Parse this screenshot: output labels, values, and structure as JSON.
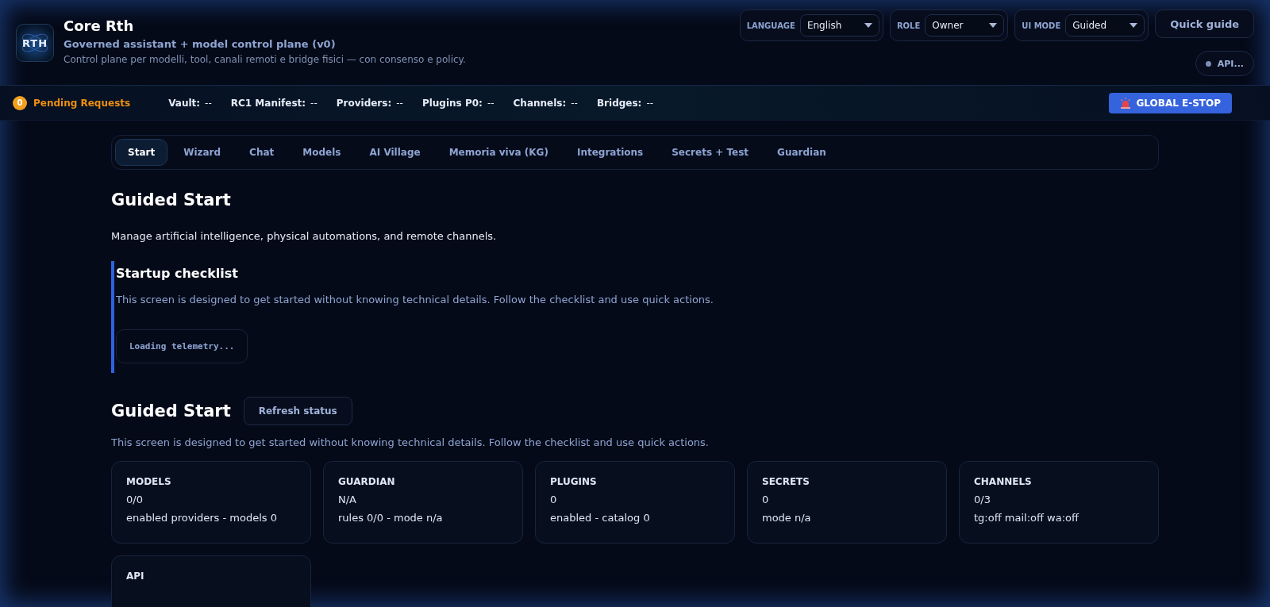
{
  "header": {
    "logo": "RTH",
    "title": "Core Rth",
    "subtitle": "Governed assistant + model control plane (v0)",
    "description": "Control plane per modelli, tool, canali remoti e bridge fisici — con consenso e policy.",
    "selects": [
      {
        "label": "LANGUAGE",
        "value": "English"
      },
      {
        "label": "ROLE",
        "value": "Owner"
      },
      {
        "label": "UI MODE",
        "value": "Guided"
      }
    ],
    "quick_guide": "Quick guide",
    "api_status": "API..."
  },
  "status_bar": {
    "pending_count": "0",
    "pending_label": "Pending Requests",
    "items": [
      {
        "label": "Vault:",
        "value": "--"
      },
      {
        "label": "RC1 Manifest:",
        "value": "--"
      },
      {
        "label": "Providers:",
        "value": "--"
      },
      {
        "label": "Plugins P0:",
        "value": "--"
      },
      {
        "label": "Channels:",
        "value": "--"
      },
      {
        "label": "Bridges:",
        "value": "--"
      }
    ],
    "estop": "GLOBAL E-STOP"
  },
  "tabs": [
    {
      "label": "Start",
      "selected": true
    },
    {
      "label": "Wizard",
      "selected": false
    },
    {
      "label": "Chat",
      "selected": false
    },
    {
      "label": "Models",
      "selected": false
    },
    {
      "label": "AI Village",
      "selected": false
    },
    {
      "label": "Memoria viva (KG)",
      "selected": false
    },
    {
      "label": "Integrations",
      "selected": false
    },
    {
      "label": "Secrets + Test",
      "selected": false
    },
    {
      "label": "Guardian",
      "selected": false
    }
  ],
  "intro": {
    "title": "Guided Start",
    "text": "Manage artificial intelligence, physical automations, and remote channels."
  },
  "checklist": {
    "title": "Startup checklist",
    "text": "This screen is designed to get started without knowing technical details. Follow the checklist and use quick actions.",
    "telemetry": "Loading telemetry..."
  },
  "status": {
    "title": "Guided Start",
    "refresh": "Refresh status",
    "text": "This screen is designed to get started without knowing technical details. Follow the checklist and use quick actions.",
    "cards": [
      {
        "title": "MODELS",
        "value": "0/0",
        "detail": "enabled providers - models 0"
      },
      {
        "title": "GUARDIAN",
        "value": "N/A",
        "detail": "rules 0/0 - mode n/a"
      },
      {
        "title": "PLUGINS",
        "value": "0",
        "detail": "enabled - catalog 0"
      },
      {
        "title": "SECRETS",
        "value": "0",
        "detail": "mode n/a"
      },
      {
        "title": "CHANNELS",
        "value": "0/3",
        "detail": "tg:off mail:off wa:off"
      },
      {
        "title": "API"
      }
    ]
  }
}
